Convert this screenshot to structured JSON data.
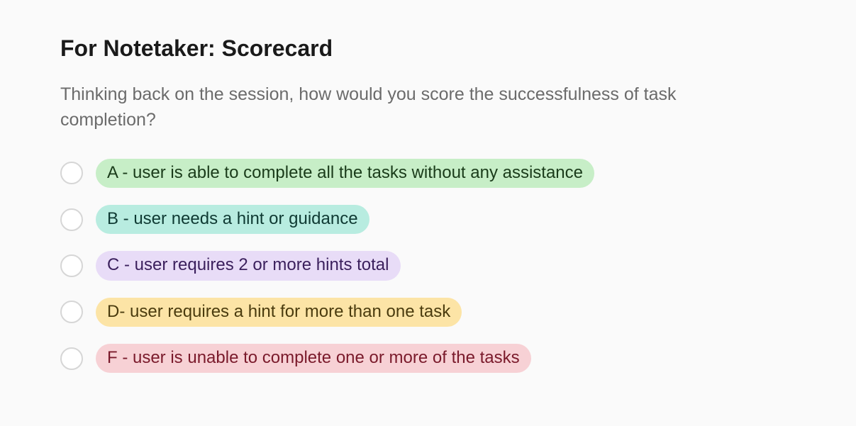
{
  "heading": "For Notetaker: Scorecard",
  "question": "Thinking back on the session, how would you score the successfulness of task completion?",
  "options": [
    {
      "label": "A - user is able to complete all the tasks without any assistance",
      "color": "green"
    },
    {
      "label": "B - user needs a hint or guidance",
      "color": "teal"
    },
    {
      "label": "C - user requires 2 or more hints total",
      "color": "purple"
    },
    {
      "label": "D- user requires a hint for more than one task",
      "color": "yellow"
    },
    {
      "label": "F - user is unable to complete one or more of the tasks",
      "color": "red"
    }
  ]
}
